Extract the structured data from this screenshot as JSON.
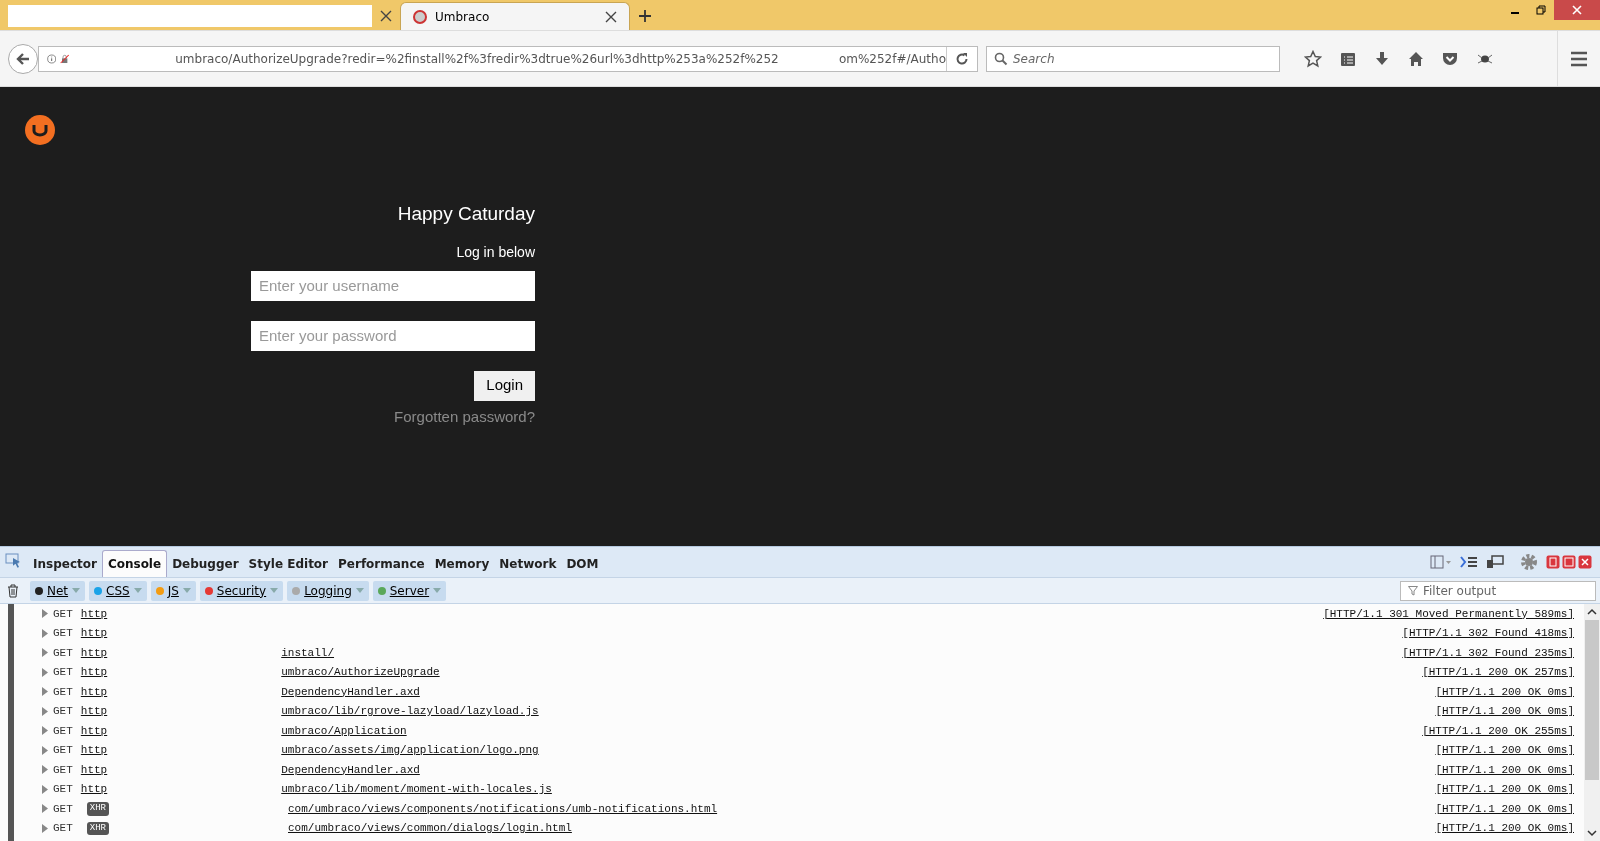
{
  "browser": {
    "tabs": [
      {
        "selected": false
      },
      {
        "title": "Umbraco",
        "selected": true
      }
    ],
    "url_parts": [
      "umbraco/AuthorizeUpgrade?redir=%2finstall%2f%3fredir%3dtrue%26url%3dhttp%253a%252f%252",
      "om%252f#/Autho"
    ],
    "search": {
      "placeholder": "Search"
    }
  },
  "login": {
    "title": "Happy Caturday",
    "subtitle": "Log in below",
    "username": {
      "placeholder": "Enter your username"
    },
    "password": {
      "placeholder": "Enter your password"
    },
    "button": "Login",
    "forgot": "Forgotten password?"
  },
  "devtools": {
    "tabs": [
      {
        "label": "Inspector",
        "selected": false
      },
      {
        "label": "Console",
        "selected": true
      },
      {
        "label": "Debugger",
        "selected": false
      },
      {
        "label": "Style Editor",
        "selected": false
      },
      {
        "label": "Performance",
        "selected": false
      },
      {
        "label": "Memory",
        "selected": false
      },
      {
        "label": "Network",
        "selected": false
      },
      {
        "label": "DOM",
        "selected": false
      }
    ],
    "filters": [
      {
        "label": "Net",
        "color": "#222222"
      },
      {
        "label": "CSS",
        "color": "#1aa3e8"
      },
      {
        "label": "JS",
        "color": "#f39c12"
      },
      {
        "label": "Security",
        "color": "#e53935"
      },
      {
        "label": "Logging",
        "color": "#aaaaaa"
      },
      {
        "label": "Server",
        "color": "#5aa85a"
      }
    ],
    "filter_output": {
      "placeholder": "Filter output"
    },
    "log": [
      {
        "method": "GET",
        "kind": "link",
        "type": "http",
        "status": "[HTTP/1.1 301 Moved Permanently 589ms]"
      },
      {
        "method": "GET",
        "kind": "link",
        "type": "http",
        "status": "[HTTP/1.1 302 Found 418ms]"
      },
      {
        "method": "GET",
        "kind": "link",
        "type": "http",
        "url": "install/",
        "status": "[HTTP/1.1 302 Found 235ms]"
      },
      {
        "method": "GET",
        "kind": "link",
        "type": "http",
        "url": "umbraco/AuthorizeUpgrade",
        "status": "[HTTP/1.1 200 OK 257ms]"
      },
      {
        "method": "GET",
        "kind": "link",
        "type": "http",
        "url": "DependencyHandler.axd",
        "status": "[HTTP/1.1 200 OK 0ms]"
      },
      {
        "method": "GET",
        "kind": "link",
        "type": "http",
        "url": "umbraco/lib/rgrove-lazyload/lazyload.js",
        "status": "[HTTP/1.1 200 OK 0ms]"
      },
      {
        "method": "GET",
        "kind": "link",
        "type": "http",
        "url": "umbraco/Application",
        "status": "[HTTP/1.1 200 OK 255ms]"
      },
      {
        "method": "GET",
        "kind": "link",
        "type": "http",
        "url": "umbraco/assets/img/application/logo.png",
        "status": "[HTTP/1.1 200 OK 0ms]"
      },
      {
        "method": "GET",
        "kind": "link",
        "type": "http",
        "url": "DependencyHandler.axd",
        "status": "[HTTP/1.1 200 OK 0ms]"
      },
      {
        "method": "GET",
        "kind": "link",
        "type": "http",
        "url": "umbraco/lib/moment/moment-with-locales.js",
        "status": "[HTTP/1.1 200 OK 0ms]"
      },
      {
        "method": "GET",
        "kind": "badge",
        "type": "XHR",
        "url": "com/umbraco/views/components/notifications/umb-notifications.html",
        "status": "[HTTP/1.1 200 OK 0ms]"
      },
      {
        "method": "GET",
        "kind": "badge",
        "type": "XHR",
        "url": "com/umbraco/views/common/dialogs/login.html",
        "status": "[HTTP/1.1 200 OK 0ms]"
      }
    ]
  }
}
